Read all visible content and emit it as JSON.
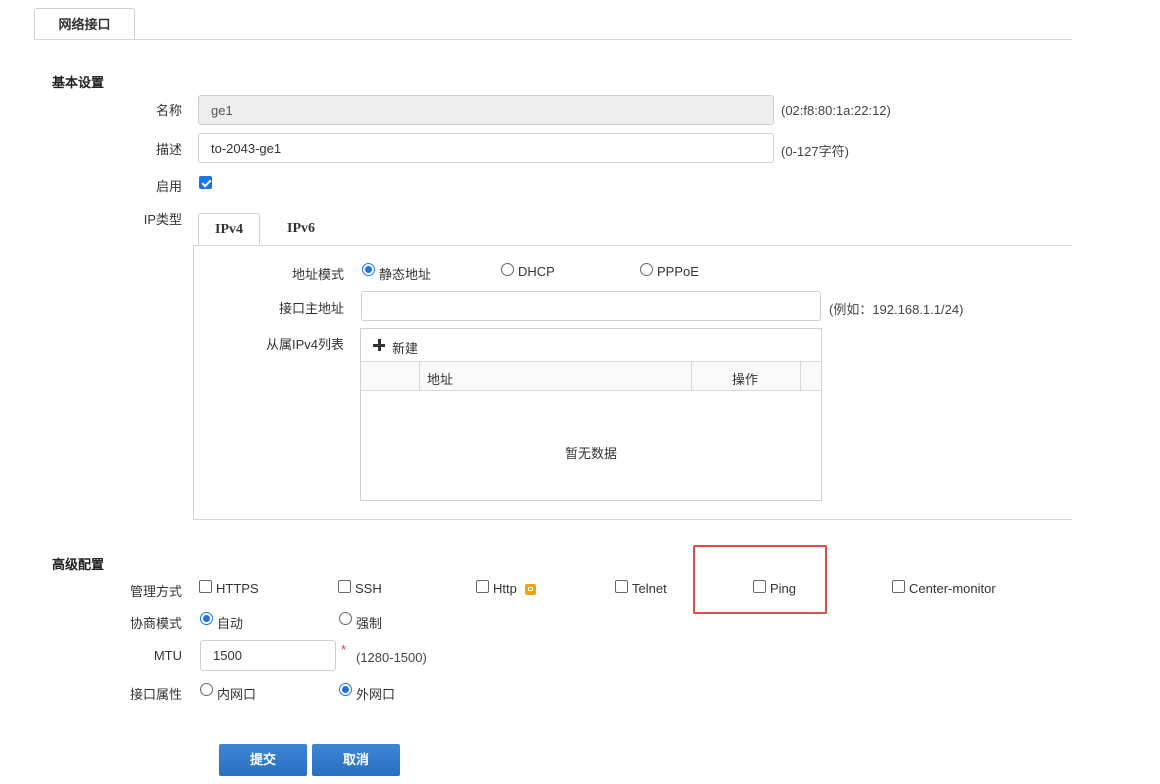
{
  "tabs": {
    "network_interface": "网络接口"
  },
  "basic": {
    "title": "基本设置",
    "name_label": "名称",
    "name_value": "ge1",
    "name_hint": "(02:f8:80:1a:22:12)",
    "desc_label": "描述",
    "desc_value": "to-2043-ge1",
    "desc_hint": "(0-127字符)",
    "enable_label": "启用",
    "enable_checked": true,
    "iptype_label": "IP类型"
  },
  "ip_tabs": {
    "ipv4": "IPv4",
    "ipv6": "IPv6",
    "active": "IPv4"
  },
  "ipv4": {
    "addr_mode_label": "地址模式",
    "modes": [
      {
        "label": "静态地址",
        "checked": true
      },
      {
        "label": "DHCP",
        "checked": false
      },
      {
        "label": "PPPoE",
        "checked": false
      }
    ],
    "primary_label": "接口主地址",
    "primary_value": "",
    "primary_hint": "(例如：192.168.1.1/24)",
    "secondary_label": "从属IPv4列表",
    "new_button": "新建",
    "columns": {
      "address": "地址",
      "actions": "操作"
    },
    "empty_text": "暂无数据"
  },
  "advanced": {
    "title": "高级配置",
    "mgmt_label": "管理方式",
    "mgmt_options": [
      {
        "label": "HTTPS",
        "checked": false
      },
      {
        "label": "SSH",
        "checked": false
      },
      {
        "label": "Http",
        "checked": false
      },
      {
        "label": "Telnet",
        "checked": false
      },
      {
        "label": "Ping",
        "checked": false
      },
      {
        "label": "Center-monitor",
        "checked": false
      }
    ],
    "nego_label": "协商模式",
    "nego_options": [
      {
        "label": "自动",
        "checked": true
      },
      {
        "label": "强制",
        "checked": false
      }
    ],
    "mtu_label": "MTU",
    "mtu_value": "1500",
    "mtu_required": "*",
    "mtu_hint": "(1280-1500)",
    "attr_label": "接口属性",
    "attr_options": [
      {
        "label": "内网口",
        "checked": false
      },
      {
        "label": "外网口",
        "checked": true
      }
    ]
  },
  "actions": {
    "submit": "提交",
    "cancel": "取消"
  },
  "colors": {
    "accent": "#1a73e8",
    "button": "#2f78c8",
    "highlight": "#e04a4a",
    "http_lock": "#f0a30a"
  }
}
